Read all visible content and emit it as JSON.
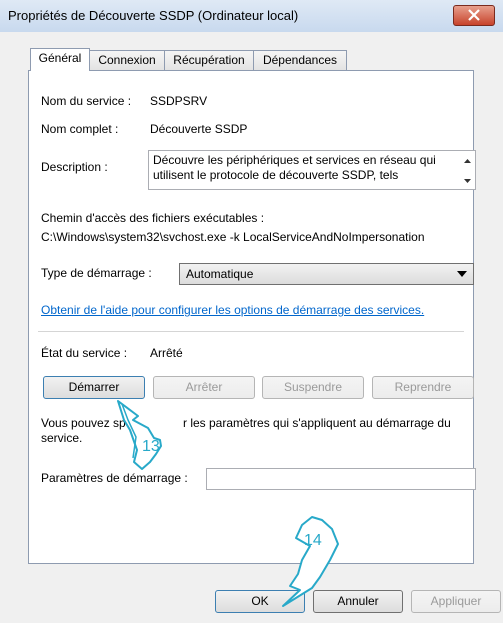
{
  "window": {
    "title": "Propriétés de Découverte SSDP (Ordinateur local)",
    "close_icon": "close-icon"
  },
  "tabs": [
    {
      "label": "Général",
      "active": true
    },
    {
      "label": "Connexion",
      "active": false
    },
    {
      "label": "Récupération",
      "active": false
    },
    {
      "label": "Dépendances",
      "active": false
    }
  ],
  "general": {
    "service_name_label": "Nom du service :",
    "service_name_value": "SSDPSRV",
    "full_name_label": "Nom complet :",
    "full_name_value": "Découverte SSDP",
    "description_label": "Description :",
    "description_value": "Découvre les périphériques et services en réseau qui utilisent le protocole de découverte SSDP, tels",
    "exec_path_label": "Chemin d'accès des fichiers exécutables :",
    "exec_path_value": "C:\\Windows\\system32\\svchost.exe -k LocalServiceAndNoImpersonation",
    "startup_type_label": "Type de démarrage :",
    "startup_type_value": "Automatique",
    "help_link": "Obtenir de l'aide pour configurer les options de démarrage des services.",
    "status_label": "État du service :",
    "status_value": "Arrêté",
    "buttons": {
      "start": "Démarrer",
      "stop": "Arrêter",
      "pause": "Suspendre",
      "resume": "Reprendre"
    },
    "params_help_line1": "Vous pouvez sp",
    "params_help_line1b": "r les paramètres qui s'appliquent au démarrage du",
    "params_help_line2": "service.",
    "start_params_label": "Paramètres de démarrage :",
    "start_params_value": ""
  },
  "footer": {
    "ok": "OK",
    "cancel": "Annuler",
    "apply": "Appliquer"
  },
  "annotations": {
    "step1": "13",
    "step2": "14",
    "accent_color": "#28a9c9"
  }
}
